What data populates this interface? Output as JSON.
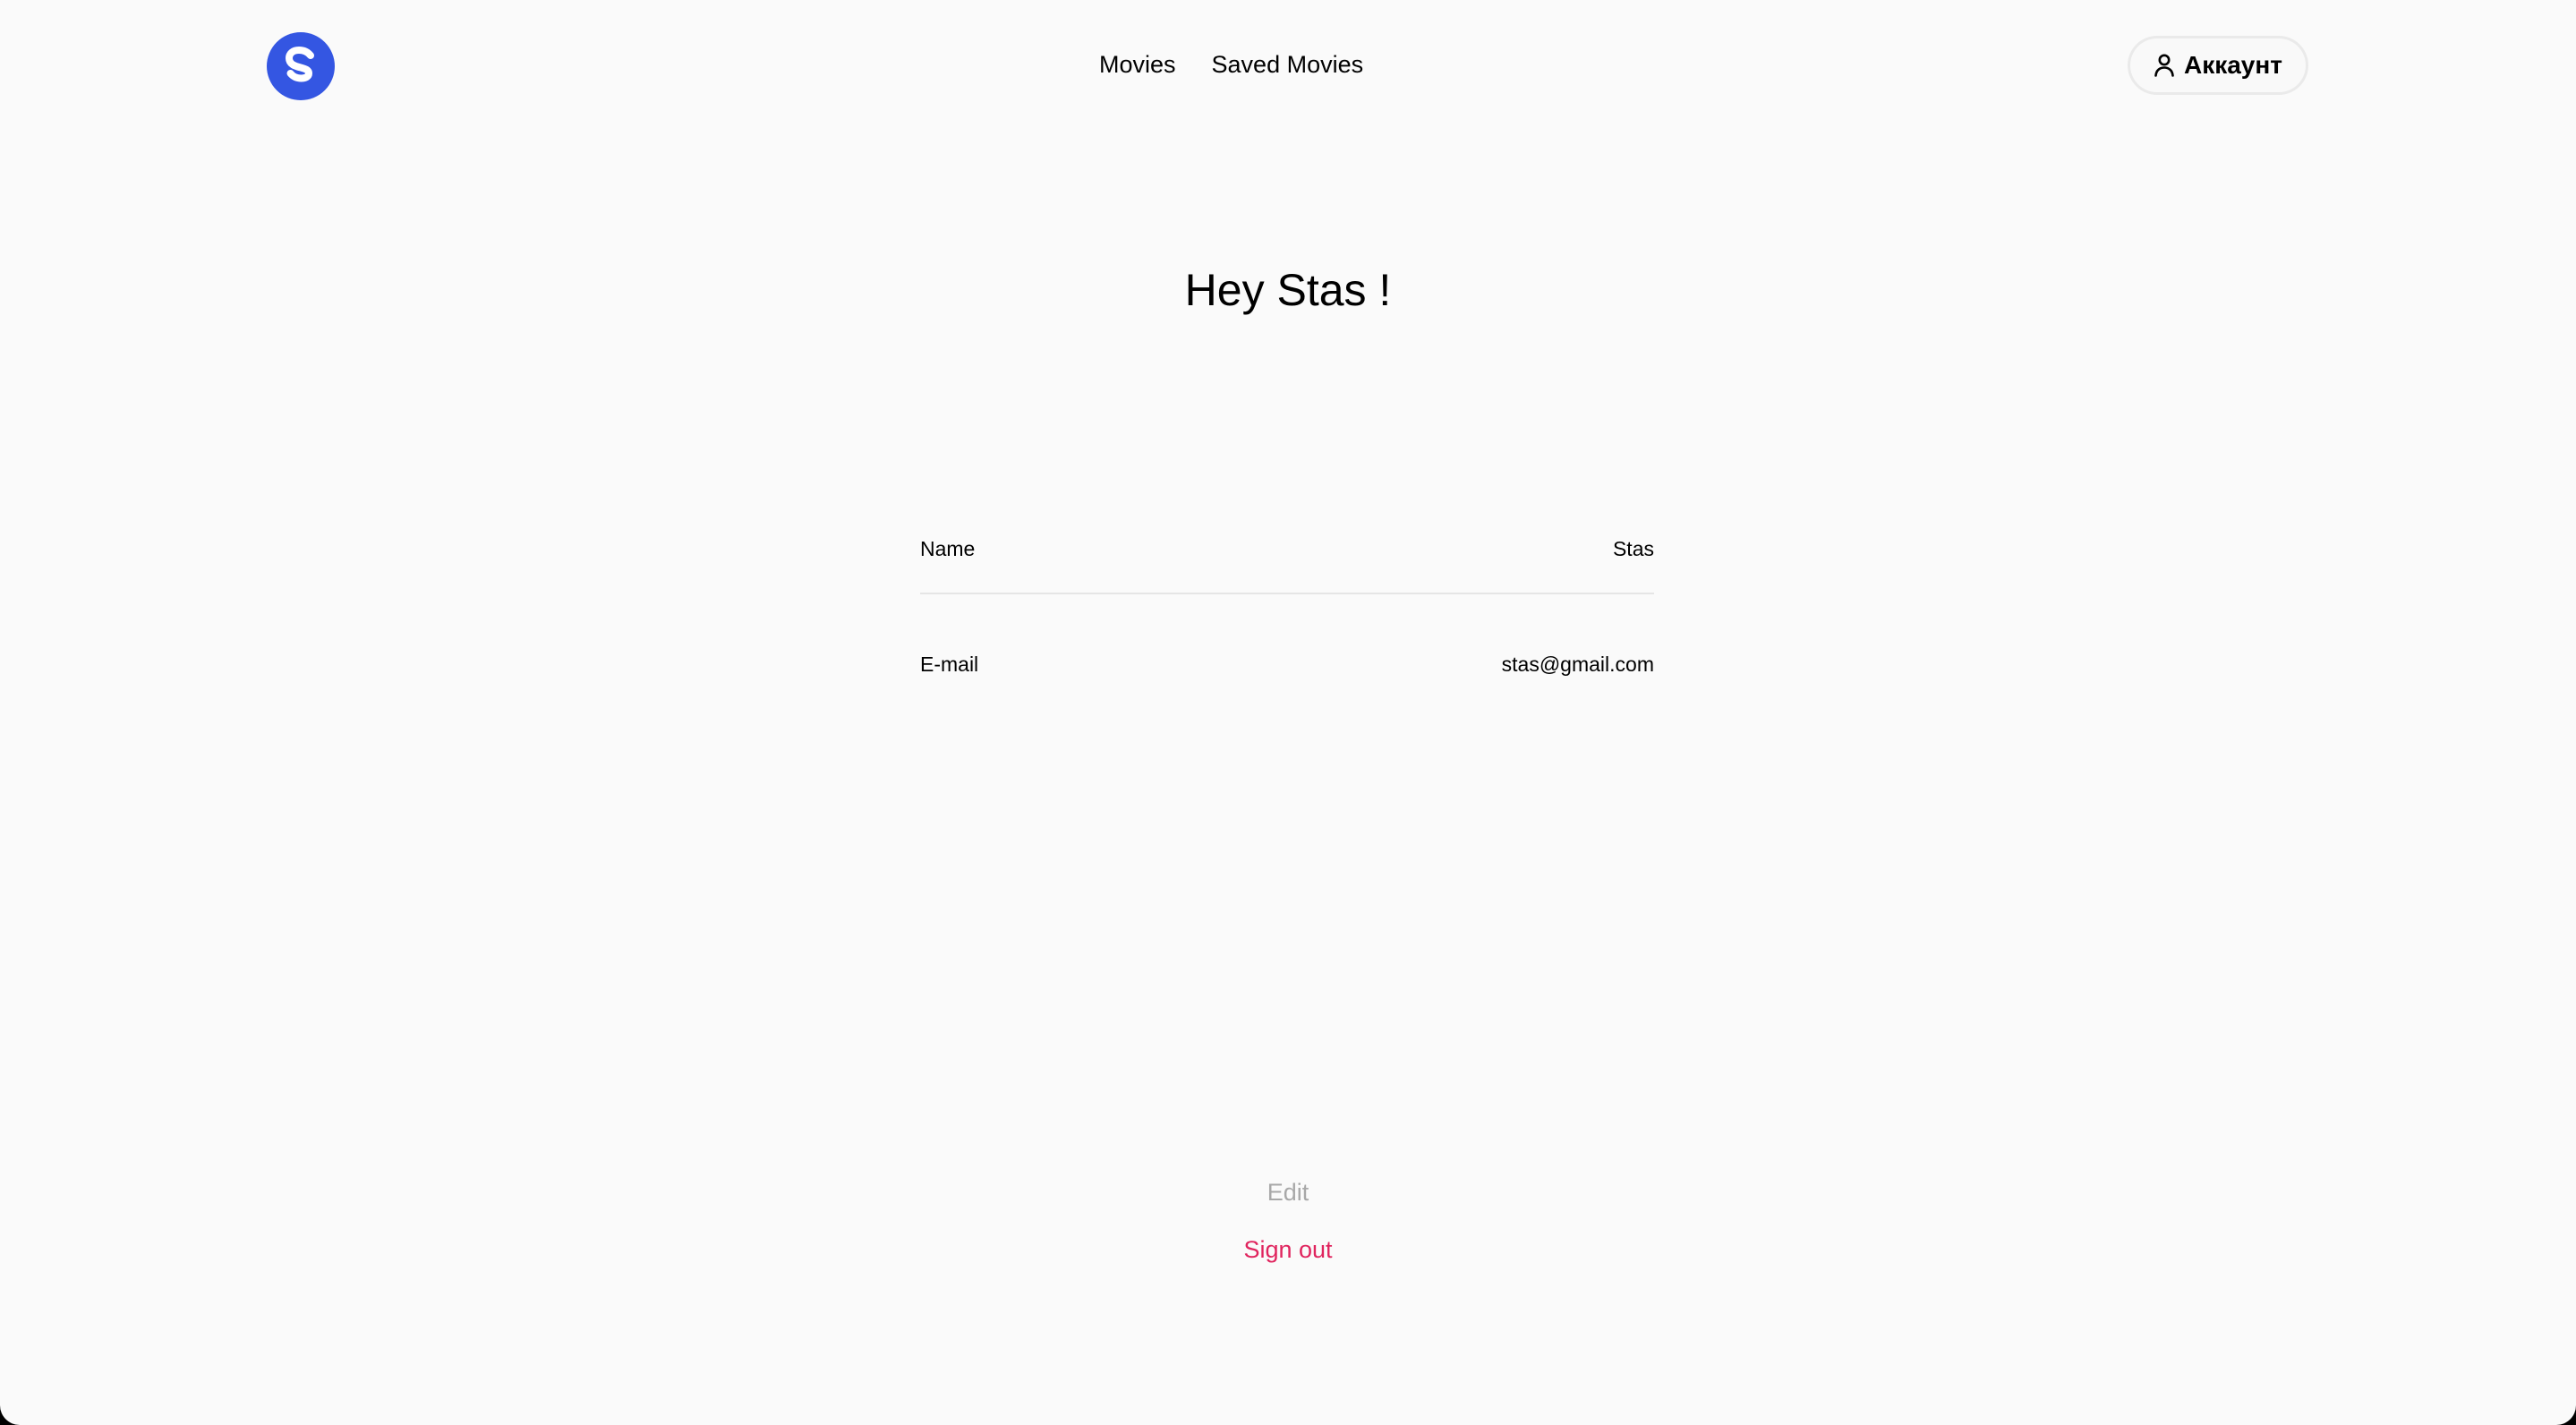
{
  "header": {
    "logo_icon": "s-logo-icon",
    "logo_color": "#3456e2",
    "nav": [
      {
        "label": "Movies"
      },
      {
        "label": "Saved Movies"
      }
    ],
    "account": {
      "label": "Аккаунт",
      "icon": "user-icon"
    }
  },
  "profile": {
    "greeting": "Hey Stas !",
    "fields": [
      {
        "label": "Name",
        "value": "Stas"
      },
      {
        "label": "E-mail",
        "value": "stas@gmail.com"
      }
    ]
  },
  "actions": {
    "edit_label": "Edit",
    "signout_label": "Sign out",
    "signout_color": "#e0245e"
  }
}
